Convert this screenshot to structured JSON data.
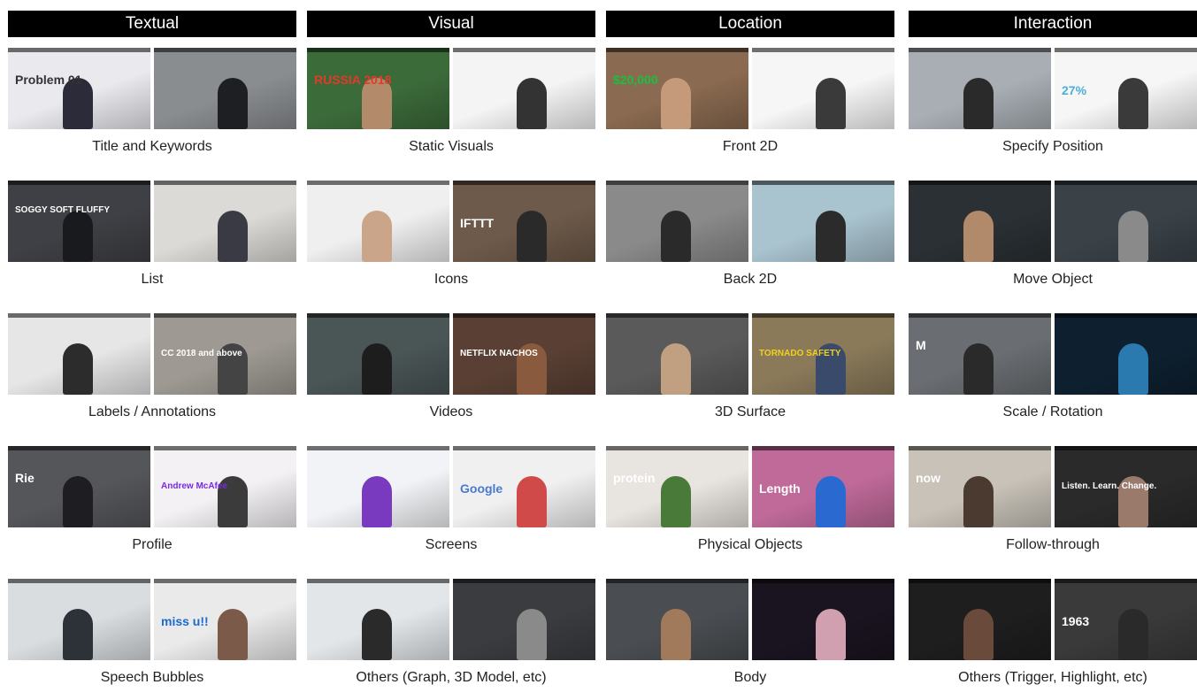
{
  "columns": [
    {
      "header": "Textual",
      "cells": [
        {
          "label": "Title and Keywords",
          "thumbs": [
            {
              "bg": "#e9e9ee",
              "accent": "#2b2b3a",
              "overlay": "Problem 01",
              "overlay_color": "#333333"
            },
            {
              "bg": "#8a8d90",
              "accent": "#1d1f22",
              "overlay": "",
              "overlay_color": "#ffffff"
            }
          ]
        },
        {
          "label": "List",
          "thumbs": [
            {
              "bg": "#3f4045",
              "accent": "#191a1d",
              "overlay": "SOGGY SOFT FLUFFY",
              "overlay_color": "#ffffff"
            },
            {
              "bg": "#dcdad6",
              "accent": "#3a3a44",
              "overlay": "",
              "overlay_color": "#4a4aa8"
            }
          ]
        },
        {
          "label": "Labels / Annotations",
          "thumbs": [
            {
              "bg": "#e6e6e6",
              "accent": "#2c2c2c",
              "overlay": "",
              "overlay_color": "#e05a3a"
            },
            {
              "bg": "#9e9a93",
              "accent": "#444444",
              "overlay": "CC 2018 and above",
              "overlay_color": "#ffffff"
            }
          ]
        },
        {
          "label": "Profile",
          "thumbs": [
            {
              "bg": "#55565a",
              "accent": "#1e1e22",
              "overlay": "Rie",
              "overlay_color": "#ffffff"
            },
            {
              "bg": "#f3f1f4",
              "accent": "#3b3b3b",
              "overlay": "Andrew McAfee",
              "overlay_color": "#7a2ae0"
            }
          ]
        },
        {
          "label": "Speech Bubbles",
          "thumbs": [
            {
              "bg": "#d9dde0",
              "accent": "#2d3238",
              "overlay": "",
              "overlay_color": "#ffffff"
            },
            {
              "bg": "#ebeaea",
              "accent": "#7b5a4a",
              "overlay": "miss u!!",
              "overlay_color": "#1a6ad0"
            }
          ]
        }
      ]
    },
    {
      "header": "Visual",
      "cells": [
        {
          "label": "Static Visuals",
          "thumbs": [
            {
              "bg": "#3c6b3a",
              "accent": "#b38a6a",
              "overlay": "RUSSIA 2018",
              "overlay_color": "#e23a2a"
            },
            {
              "bg": "#f4f4f4",
              "accent": "#333333",
              "overlay": "",
              "overlay_color": "#333333"
            }
          ]
        },
        {
          "label": "Icons",
          "thumbs": [
            {
              "bg": "#efefef",
              "accent": "#caa58a",
              "overlay": "",
              "overlay_color": "#8a5ad0"
            },
            {
              "bg": "#6e5a4a",
              "accent": "#2a2a2a",
              "overlay": "IFTTT",
              "overlay_color": "#ffffff"
            }
          ]
        },
        {
          "label": "Videos",
          "thumbs": [
            {
              "bg": "#4a5556",
              "accent": "#1d1d1d",
              "overlay": "",
              "overlay_color": "#ffffff"
            },
            {
              "bg": "#5a4034",
              "accent": "#8a5a3e",
              "overlay": "NETFLIX NACHOS",
              "overlay_color": "#ffffff"
            }
          ]
        },
        {
          "label": "Screens",
          "thumbs": [
            {
              "bg": "#f2f3f6",
              "accent": "#7a3ac0",
              "overlay": "",
              "overlay_color": "#6a5ae0"
            },
            {
              "bg": "#f0f0f0",
              "accent": "#d04a4a",
              "overlay": "Google",
              "overlay_color": "#4a7ad0"
            }
          ]
        },
        {
          "label": "Others (Graph, 3D Model, etc)",
          "thumbs": [
            {
              "bg": "#e2e6e9",
              "accent": "#2a2a2a",
              "overlay": "",
              "overlay_color": "#4ab0c8"
            },
            {
              "bg": "#3a3c40",
              "accent": "#8a8a8a",
              "overlay": "",
              "overlay_color": "#ffffff"
            }
          ]
        }
      ]
    },
    {
      "header": "Location",
      "cells": [
        {
          "label": "Front 2D",
          "thumbs": [
            {
              "bg": "#8a6a50",
              "accent": "#c49a7a",
              "overlay": "$20,000",
              "overlay_color": "#1ac040"
            },
            {
              "bg": "#f6f6f6",
              "accent": "#3a3a3a",
              "overlay": "",
              "overlay_color": "#7a9ae0"
            }
          ]
        },
        {
          "label": "Back 2D",
          "thumbs": [
            {
              "bg": "#8a8a8a",
              "accent": "#2a2a2a",
              "overlay": "",
              "overlay_color": "#ffffff"
            },
            {
              "bg": "#a9c3cf",
              "accent": "#2b2b2b",
              "overlay": "",
              "overlay_color": "#ffffff"
            }
          ]
        },
        {
          "label": "3D Surface",
          "thumbs": [
            {
              "bg": "#5a5a5a",
              "accent": "#c0a080",
              "overlay": "",
              "overlay_color": "#ffffff"
            },
            {
              "bg": "#8a7a5a",
              "accent": "#3a4a6a",
              "overlay": "TORNADO SAFETY",
              "overlay_color": "#f0d020"
            }
          ]
        },
        {
          "label": "Physical Objects",
          "thumbs": [
            {
              "bg": "#e8e4df",
              "accent": "#4a7a3a",
              "overlay": "protein",
              "overlay_color": "#ffffff"
            },
            {
              "bg": "#c06a9a",
              "accent": "#2a6ad0",
              "overlay": "Length",
              "overlay_color": "#ffffff"
            }
          ]
        },
        {
          "label": "Body",
          "thumbs": [
            {
              "bg": "#4a4e52",
              "accent": "#a07a5a",
              "overlay": "",
              "overlay_color": "#ffffff"
            },
            {
              "bg": "#1a1420",
              "accent": "#d0a0b0",
              "overlay": "",
              "overlay_color": "#ffffff"
            }
          ]
        }
      ]
    },
    {
      "header": "Interaction",
      "cells": [
        {
          "label": "Specify Position",
          "thumbs": [
            {
              "bg": "#a8aeb4",
              "accent": "#2a2a2a",
              "overlay": "",
              "overlay_color": "#ffffff"
            },
            {
              "bg": "#f6f6f6",
              "accent": "#3a3a3a",
              "overlay": "27%",
              "overlay_color": "#4ab0d8"
            }
          ]
        },
        {
          "label": "Move Object",
          "thumbs": [
            {
              "bg": "#2a3034",
              "accent": "#b08a6a",
              "overlay": "",
              "overlay_color": "#ffffff"
            },
            {
              "bg": "#3a4248",
              "accent": "#8a8a8a",
              "overlay": "",
              "overlay_color": "#ffffff"
            }
          ]
        },
        {
          "label": "Scale / Rotation",
          "thumbs": [
            {
              "bg": "#6a6e72",
              "accent": "#2a2a2a",
              "overlay": "M",
              "overlay_color": "#ffffff"
            },
            {
              "bg": "#0e2030",
              "accent": "#2a7ab0",
              "overlay": "",
              "overlay_color": "#4ac0e0"
            }
          ]
        },
        {
          "label": "Follow-through",
          "thumbs": [
            {
              "bg": "#c8c2b8",
              "accent": "#4a3a30",
              "overlay": "now",
              "overlay_color": "#ffffff"
            },
            {
              "bg": "#2a2a2a",
              "accent": "#9a7a6a",
              "overlay": "Listen. Learn. Change.",
              "overlay_color": "#ffffff"
            }
          ]
        },
        {
          "label": "Others (Trigger, Highlight, etc)",
          "thumbs": [
            {
              "bg": "#1e1e1e",
              "accent": "#6a4a3a",
              "overlay": "",
              "overlay_color": "#e0e040"
            },
            {
              "bg": "#3a3a3a",
              "accent": "#2a2a2a",
              "overlay": "1963",
              "overlay_color": "#ffffff"
            }
          ]
        }
      ]
    }
  ]
}
